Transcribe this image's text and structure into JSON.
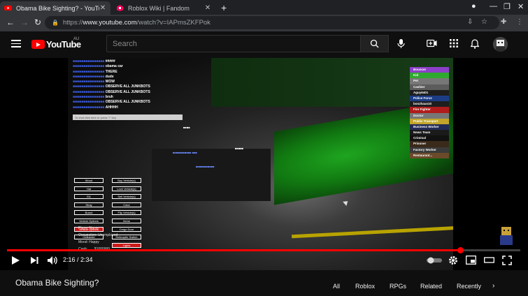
{
  "browser": {
    "tabs": [
      {
        "title": "Obama Bike Sighting? - YouTube",
        "active": true,
        "favicon": "youtube-favicon"
      },
      {
        "title": "Roblox Wiki | Fandom",
        "active": false,
        "favicon": "fandom-favicon"
      }
    ],
    "url": {
      "scheme": "https://",
      "host": "www.youtube.com",
      "rest": "/watch?v=IAPmsZKFPok"
    }
  },
  "youtube": {
    "logo_text": "YouTube",
    "country_code": "AU",
    "search_placeholder": "Search"
  },
  "video": {
    "title": "Obama Bike Sighting?",
    "current_time": "2:16",
    "duration": "2:34",
    "progress_fraction": 0.883
  },
  "game": {
    "chat": [
      {
        "name": "",
        "msg": "#####"
      },
      {
        "name": "",
        "msg": "obama car"
      },
      {
        "name": "",
        "msg": "THERE"
      },
      {
        "name": "",
        "msg": "dude"
      },
      {
        "name": "",
        "msg": "WOW"
      },
      {
        "name": "",
        "msg": "OBSERVE ALL JUNKBOTS"
      },
      {
        "name": "",
        "msg": "OBSERVE ALL JUNKBOTS"
      },
      {
        "name": "",
        "msg": "bruh"
      },
      {
        "name": "",
        "msg": "OBSERVE ALL JUNKBOTS"
      },
      {
        "name": "",
        "msg": "AHHHH"
      }
    ],
    "chat_placeholder": "To chat click here or press \"/\" key",
    "buttons_left": [
      "Wood",
      "Hat",
      "EA",
      "Stray",
      "Board",
      "Vehicle Options",
      "Vehicle Options",
      "Character"
    ],
    "buttons_right": [
      "Buy Vehicle(s)",
      "Love Vehicle(s)",
      "Sell Vehicle(s)",
      "Color",
      "Flip Vehicle(s)",
      "Items",
      "Cargo Door",
      "Helicopter Switch",
      "Lights"
    ],
    "stats": {
      "player_name": "Player Name:",
      "occupation": "Occupation: Unemployed",
      "mood": "Mood: Happy",
      "cash_label": "Cash:",
      "cash_value": "$1000000"
    },
    "teams": [
      {
        "name": "Bouncer",
        "color": "#8d3fc8"
      },
      {
        "name": "Kid",
        "color": "#2fa82f"
      },
      {
        "name": "Pet",
        "color": "#777777"
      },
      {
        "name": "Cashier",
        "color": "#5c5c5c"
      },
      {
        "name": "Aguy6401",
        "color": "#1e1e1e"
      },
      {
        "name": "Police Force",
        "color": "#1c3d85"
      },
      {
        "name": "bonzhaus10",
        "color": "#1e1e1e"
      },
      {
        "name": "Fire Fighter",
        "color": "#b01c1c"
      },
      {
        "name": "Doctor",
        "color": "#777777"
      },
      {
        "name": "Public Transport",
        "color": "#c2a52a"
      },
      {
        "name": "Business Worker",
        "color": "#222a55"
      },
      {
        "name": "News Team",
        "color": "#1a1a1a"
      },
      {
        "name": "Criminal",
        "color": "#111111"
      },
      {
        "name": "Prisoner",
        "color": "#3a2a1a"
      },
      {
        "name": "Factory Worker",
        "color": "#3a3a3a"
      },
      {
        "name": "Restaurant...",
        "color": "#6b4a2a"
      }
    ]
  },
  "chips": [
    "All",
    "Roblox",
    "RPGs",
    "Related",
    "Recently"
  ]
}
